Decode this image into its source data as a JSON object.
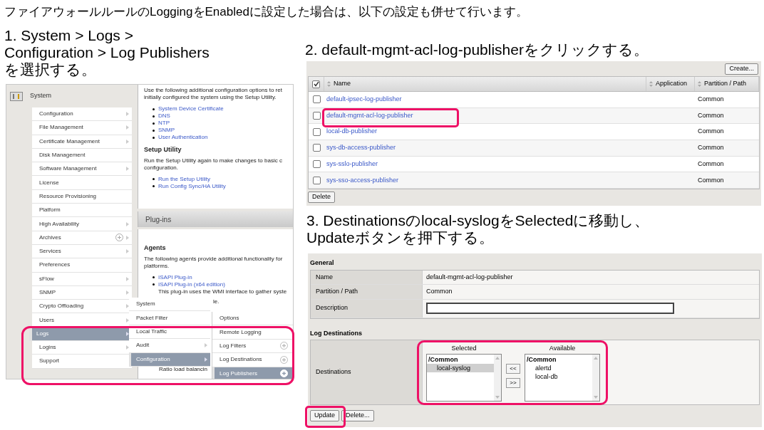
{
  "heading": "ファイアウォールルールのLoggingをEnabledに設定した場合は、以下の設定も併せて行います。",
  "step1": {
    "caption_lines": [
      "1. System > Logs >",
      "Configuration > Log Publishers",
      "を選択する。"
    ]
  },
  "system_panel": {
    "title": "System",
    "menu": [
      {
        "label": "Configuration",
        "arrow": true,
        "add": false,
        "selected": false
      },
      {
        "label": "File Management",
        "arrow": true,
        "add": false,
        "selected": false
      },
      {
        "label": "Certificate Management",
        "arrow": true,
        "add": false,
        "selected": false
      },
      {
        "label": "Disk Management",
        "arrow": false,
        "add": false,
        "selected": false
      },
      {
        "label": "Software Management",
        "arrow": true,
        "add": false,
        "selected": false
      },
      {
        "label": "License",
        "arrow": false,
        "add": false,
        "selected": false
      },
      {
        "label": "Resource Provisioning",
        "arrow": false,
        "add": false,
        "selected": false
      },
      {
        "label": "Platform",
        "arrow": false,
        "add": false,
        "selected": false
      },
      {
        "label": "High Availability",
        "arrow": true,
        "add": false,
        "selected": false
      },
      {
        "label": "Archives",
        "arrow": true,
        "add": true,
        "selected": false
      },
      {
        "label": "Services",
        "arrow": true,
        "add": false,
        "selected": false
      },
      {
        "label": "Preferences",
        "arrow": false,
        "add": false,
        "selected": false
      },
      {
        "label": "sFlow",
        "arrow": true,
        "add": false,
        "selected": false
      },
      {
        "label": "SNMP",
        "arrow": true,
        "add": false,
        "selected": false
      },
      {
        "label": "Crypto Offloading",
        "arrow": true,
        "add": false,
        "selected": false
      },
      {
        "label": "Users",
        "arrow": true,
        "add": false,
        "selected": false
      },
      {
        "label": "Logs",
        "arrow": true,
        "add": false,
        "selected": true
      },
      {
        "label": "Logins",
        "arrow": true,
        "add": false,
        "selected": false
      },
      {
        "label": "Support",
        "arrow": false,
        "add": false,
        "selected": false
      }
    ],
    "intro_lines": [
      "Use the following additional configuration options to ret",
      "initially configured the system using the Setup Utility."
    ],
    "links": [
      "System Device Certificate",
      "DNS",
      "NTP",
      "SNMP",
      "User Authentication"
    ],
    "setup_title": "Setup Utility",
    "setup_lines": [
      "Run the Setup Utility again to make changes to basic c",
      "configuration."
    ],
    "setup_links": [
      "Run the Setup Utility",
      "Run Config Sync/HA Utility"
    ],
    "plugins_title": "Plug-ins",
    "agents_title": "Agents",
    "agents_lines": [
      "The following agents provide additional functionality for",
      "platforms."
    ],
    "agent_links": [
      "ISAPI Plug-in",
      "ISAPI Plug-in (x64 edition)"
    ],
    "agent_note": "This plug-in uses the WMI interface to gather syste",
    "agent_note_tail": "le.",
    "ratio_text": "Ratio load balancin",
    "flyout_1": [
      {
        "label": "System",
        "arrow": false,
        "selected": false
      },
      {
        "label": "Packet Filter",
        "arrow": false,
        "selected": false
      },
      {
        "label": "Local Traffic",
        "arrow": false,
        "selected": false
      },
      {
        "label": "Audit",
        "arrow": true,
        "selected": false
      },
      {
        "label": "Configuration",
        "arrow": true,
        "selected": true
      }
    ],
    "flyout_2": [
      {
        "label": "Options",
        "add": false,
        "selected": false
      },
      {
        "label": "Remote Logging",
        "add": false,
        "selected": false
      },
      {
        "label": "Log Filters",
        "add": true,
        "selected": false
      },
      {
        "label": "Log Destinations",
        "add": true,
        "selected": false
      },
      {
        "label": "Log Publishers",
        "add": true,
        "selected": true
      }
    ]
  },
  "step2": {
    "caption": "2. default-mgmt-acl-log-publisherをクリックする。"
  },
  "publishers_panel": {
    "create_button": "Create...",
    "header_checked": true,
    "columns": [
      "Name",
      "Application",
      "Partition / Path"
    ],
    "rows": [
      {
        "name": "default-ipsec-log-publisher",
        "partition": "Common",
        "checked": false
      },
      {
        "name": "default-mgmt-acl-log-publisher",
        "partition": "Common",
        "checked": false
      },
      {
        "name": "local-db-publisher",
        "partition": "Common",
        "checked": false
      },
      {
        "name": "sys-db-access-publisher",
        "partition": "Common",
        "checked": false
      },
      {
        "name": "sys-sslo-publisher",
        "partition": "Common",
        "checked": false
      },
      {
        "name": "sys-sso-access-publisher",
        "partition": "Common",
        "checked": false
      }
    ],
    "delete_button": "Delete"
  },
  "step3": {
    "caption_lines": [
      "3. Destinationsのlocal-syslogをSelectedに移動し、",
      "Updateボタンを押下する。"
    ]
  },
  "properties_panel": {
    "general_title": "General",
    "fields": [
      {
        "label": "Name",
        "value": "default-mgmt-acl-log-publisher",
        "kind": "text"
      },
      {
        "label": "Partition / Path",
        "value": "Common",
        "kind": "text"
      },
      {
        "label": "Description",
        "kind": "input"
      }
    ],
    "destinations_title": "Log Destinations",
    "destinations_label": "Destinations",
    "selected_title": "Selected",
    "selected_group": "/Common",
    "selected_items": [
      {
        "label": "local-syslog",
        "selected": true
      }
    ],
    "available_title": "Available",
    "available_group": "/Common",
    "available_items": [
      {
        "label": "alertd",
        "selected": false
      },
      {
        "label": "local-db",
        "selected": false
      }
    ],
    "move_left": "<<",
    "move_right": ">>",
    "update_button": "Update",
    "delete_button": "Delete..."
  }
}
